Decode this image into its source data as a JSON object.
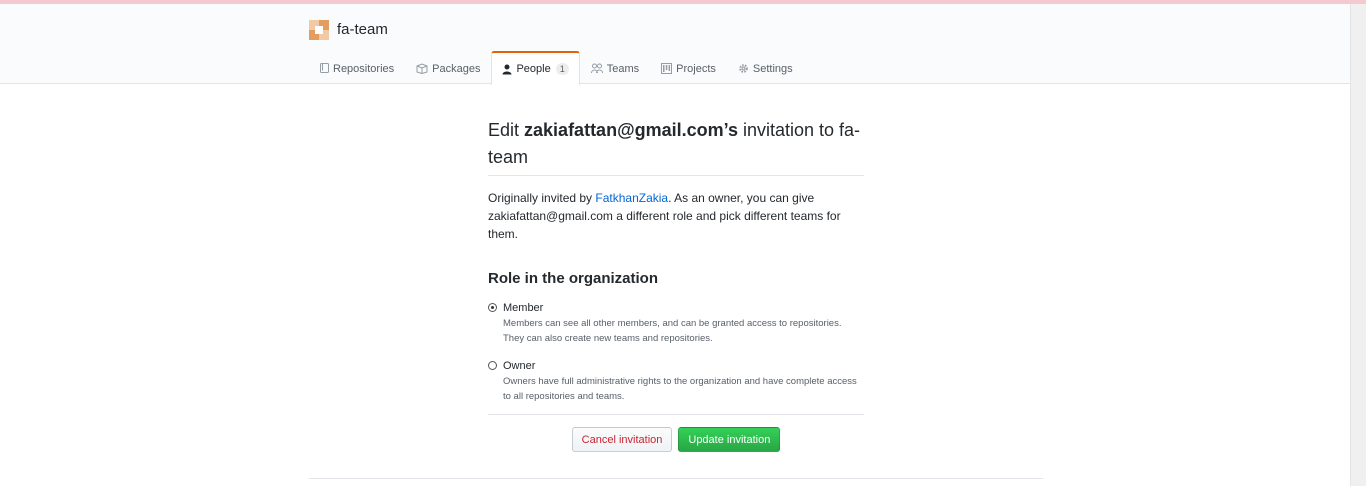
{
  "org": {
    "name": "fa-team"
  },
  "tabs": [
    {
      "label": "Repositories",
      "icon": "repo-icon"
    },
    {
      "label": "Packages",
      "icon": "package-icon"
    },
    {
      "label": "People",
      "icon": "person-icon",
      "counter": "1",
      "selected": true
    },
    {
      "label": "Teams",
      "icon": "people-icon"
    },
    {
      "label": "Projects",
      "icon": "project-icon"
    },
    {
      "label": "Settings",
      "icon": "gear-icon"
    }
  ],
  "main": {
    "title_prefix": "Edit ",
    "title_email": "zakiafattan@gmail.com’s",
    "title_suffix": " invitation to fa-team",
    "intro_prefix": "Originally invited by ",
    "intro_link": "FatkhanZakia",
    "intro_suffix": ". As an owner, you can give zakiafattan@gmail.com a different role and pick different teams for them.",
    "role_heading": "Role in the organization",
    "roles": [
      {
        "label": "Member",
        "note": "Members can see all other members, and can be granted access to repositories. They can also create new teams and repositories.",
        "checked": true
      },
      {
        "label": "Owner",
        "note": "Owners have full administrative rights to the organization and have complete access to all repositories and teams.",
        "checked": false
      }
    ],
    "cancel_label": "Cancel invitation",
    "update_label": "Update invitation"
  },
  "colors": {
    "accent_tab": "#e36209",
    "link": "#0366d6",
    "primary_button": "#28a745",
    "danger_text": "#cb2431"
  }
}
